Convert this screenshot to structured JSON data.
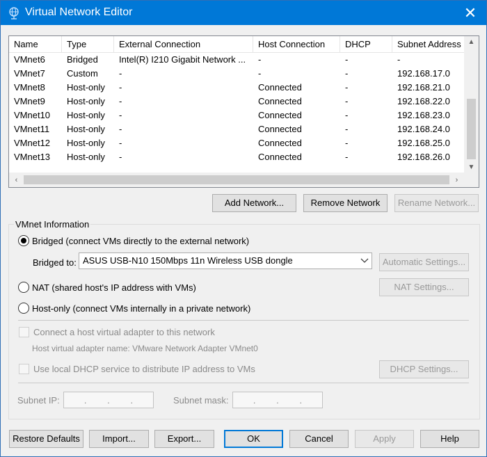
{
  "window": {
    "title": "Virtual Network Editor",
    "close_glyph": "✕"
  },
  "list": {
    "columns": [
      "Name",
      "Type",
      "External Connection",
      "Host Connection",
      "DHCP",
      "Subnet Address"
    ],
    "rows": [
      [
        "VMnet6",
        "Bridged",
        "Intel(R) I210 Gigabit Network ...",
        "-",
        "-",
        "-"
      ],
      [
        "VMnet7",
        "Custom",
        "-",
        "-",
        "-",
        "192.168.17.0"
      ],
      [
        "VMnet8",
        "Host-only",
        "-",
        "Connected",
        "-",
        "192.168.21.0"
      ],
      [
        "VMnet9",
        "Host-only",
        "-",
        "Connected",
        "-",
        "192.168.22.0"
      ],
      [
        "VMnet10",
        "Host-only",
        "-",
        "Connected",
        "-",
        "192.168.23.0"
      ],
      [
        "VMnet11",
        "Host-only",
        "-",
        "Connected",
        "-",
        "192.168.24.0"
      ],
      [
        "VMnet12",
        "Host-only",
        "-",
        "Connected",
        "-",
        "192.168.25.0"
      ],
      [
        "VMnet13",
        "Host-only",
        "-",
        "Connected",
        "-",
        "192.168.26.0"
      ]
    ]
  },
  "list_buttons": {
    "add": "Add Network...",
    "remove": "Remove Network",
    "rename": "Rename Network..."
  },
  "vmnet_info": {
    "title": "VMnet Information",
    "bridged_label": "Bridged (connect VMs directly to the external network)",
    "bridged_to_label": "Bridged to:",
    "bridged_to_value": "ASUS USB-N10 150Mbps 11n Wireless USB dongle",
    "automatic_settings": "Automatic Settings...",
    "nat_label": "NAT (shared host's IP address with VMs)",
    "nat_settings": "NAT Settings...",
    "hostonly_label": "Host-only (connect VMs internally in a private network)",
    "connect_adapter_label": "Connect a host virtual adapter to this network",
    "adapter_name_label": "Host virtual adapter name: VMware Network Adapter VMnet0",
    "dhcp_label": "Use local DHCP service to distribute IP address to VMs",
    "dhcp_settings": "DHCP Settings...",
    "subnet_ip_label": "Subnet IP:",
    "subnet_mask_label": "Subnet mask:",
    "selected_mode": "bridged"
  },
  "footer": {
    "restore": "Restore Defaults",
    "import": "Import...",
    "export": "Export...",
    "ok": "OK",
    "cancel": "Cancel",
    "apply": "Apply",
    "help": "Help"
  },
  "colors": {
    "titlebar": "#0078d7",
    "default_button_border": "#0078d7"
  }
}
